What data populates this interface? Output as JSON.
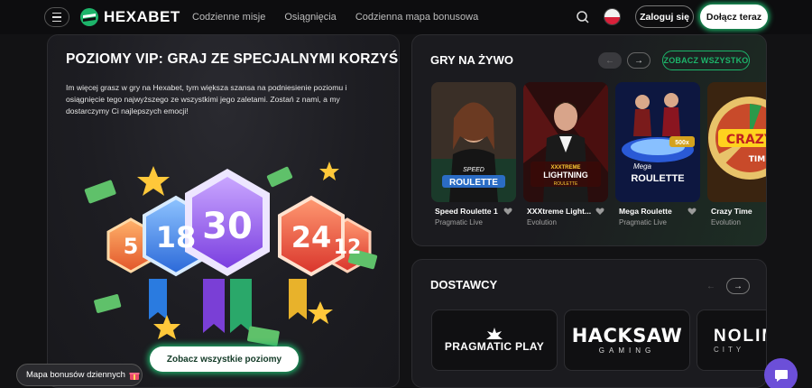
{
  "header": {
    "brand": "HEXABET",
    "nav": [
      "Codzienne misje",
      "Osiągnięcia",
      "Codzienna mapa bonusowa"
    ],
    "login_label": "Zaloguj się",
    "join_label": "Dołącz teraz",
    "icons": [
      "menu-icon",
      "search-icon",
      "poland-flag-icon"
    ]
  },
  "vip": {
    "title": "POZIOMY VIP: GRAJ ZE SPECJALNYMI KORZYŚCIAMI",
    "text": "Im więcej grasz w gry na Hexabet, tym większa szansa na podniesienie poziomu i osiągnięcie tego najwyższego ze wszystkimi jego zaletami. Zostań z nami, a my dostarczymy Ci najlepszych emocji!",
    "badges": [
      "5",
      "18",
      "30",
      "24",
      "12"
    ],
    "button_label": "Zobacz wszystkie poziomy"
  },
  "live": {
    "title": "GRY NA ŻYWO",
    "see_all_label": "ZOBACZ WSZYSTKO",
    "games": [
      {
        "name": "Speed Roulette 1",
        "provider": "Pragmatic Live",
        "art": "SPEED ROULETTE"
      },
      {
        "name": "XXXtreme Light...",
        "provider": "Evolution",
        "art": "XXXTREME LIGHTNING ROULETTE"
      },
      {
        "name": "Mega Roulette",
        "provider": "Pragmatic Live",
        "art": "Mega ROULETTE",
        "badge": "500x"
      },
      {
        "name": "Crazy Time",
        "provider": "Evolution",
        "art": "CRAZY TIME"
      }
    ]
  },
  "providers": {
    "title": "DOSTAWCY",
    "logos": [
      {
        "name": "PRAGMATIC PLAY"
      },
      {
        "name": "HACKSAW",
        "sub": "GAMING"
      },
      {
        "name": "NOLIMIT",
        "sub": "CITY"
      }
    ]
  },
  "bonus_map_label": "Mapa bonusów dziennych",
  "colors": {
    "accent": "#1db46a",
    "background": "#121214",
    "panel": "#1b1b1f",
    "chat": "#6c4fd8"
  }
}
